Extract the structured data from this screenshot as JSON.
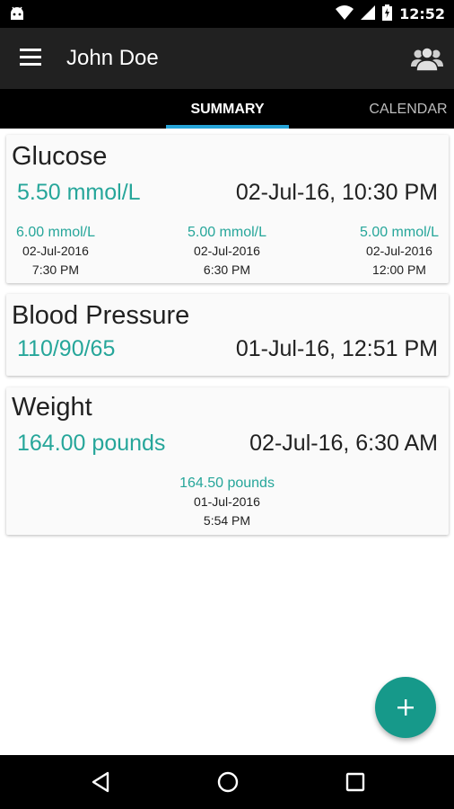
{
  "status_bar": {
    "time": "12:52",
    "icons": [
      "android-icon",
      "wifi-icon",
      "signal-icon",
      "battery-charging-icon"
    ]
  },
  "app_bar": {
    "title": "John Doe",
    "menu_icon": "hamburger-menu-icon",
    "action_icon": "group-users-icon"
  },
  "tabs": [
    {
      "label": "SUMMARY",
      "active": true
    },
    {
      "label": "CALENDAR",
      "active": false
    }
  ],
  "cards": {
    "glucose": {
      "title": "Glucose",
      "value": "5.50 mmol/L",
      "datetime": "02-Jul-16, 10:30 PM",
      "history": [
        {
          "value": "6.00 mmol/L",
          "date": "02-Jul-2016",
          "time": "7:30 PM"
        },
        {
          "value": "5.00 mmol/L",
          "date": "02-Jul-2016",
          "time": "6:30 PM"
        },
        {
          "value": "5.00 mmol/L",
          "date": "02-Jul-2016",
          "time": "12:00 PM"
        }
      ]
    },
    "blood_pressure": {
      "title": "Blood Pressure",
      "value": "110/90/65",
      "datetime": "01-Jul-16, 12:51 PM"
    },
    "weight": {
      "title": "Weight",
      "value": "164.00 pounds",
      "datetime": "02-Jul-16, 6:30 AM",
      "history": [
        {
          "value": "164.50 pounds",
          "date": "01-Jul-2016",
          "time": "5:54 PM"
        }
      ]
    }
  },
  "fab": {
    "icon": "plus-icon"
  },
  "nav_bar": {
    "icons": [
      "back-icon",
      "home-icon",
      "recents-icon"
    ]
  },
  "colors": {
    "accent": "#26a69a",
    "fab": "#16998a",
    "tab_indicator": "#26a4d8",
    "app_bar": "#212121"
  }
}
